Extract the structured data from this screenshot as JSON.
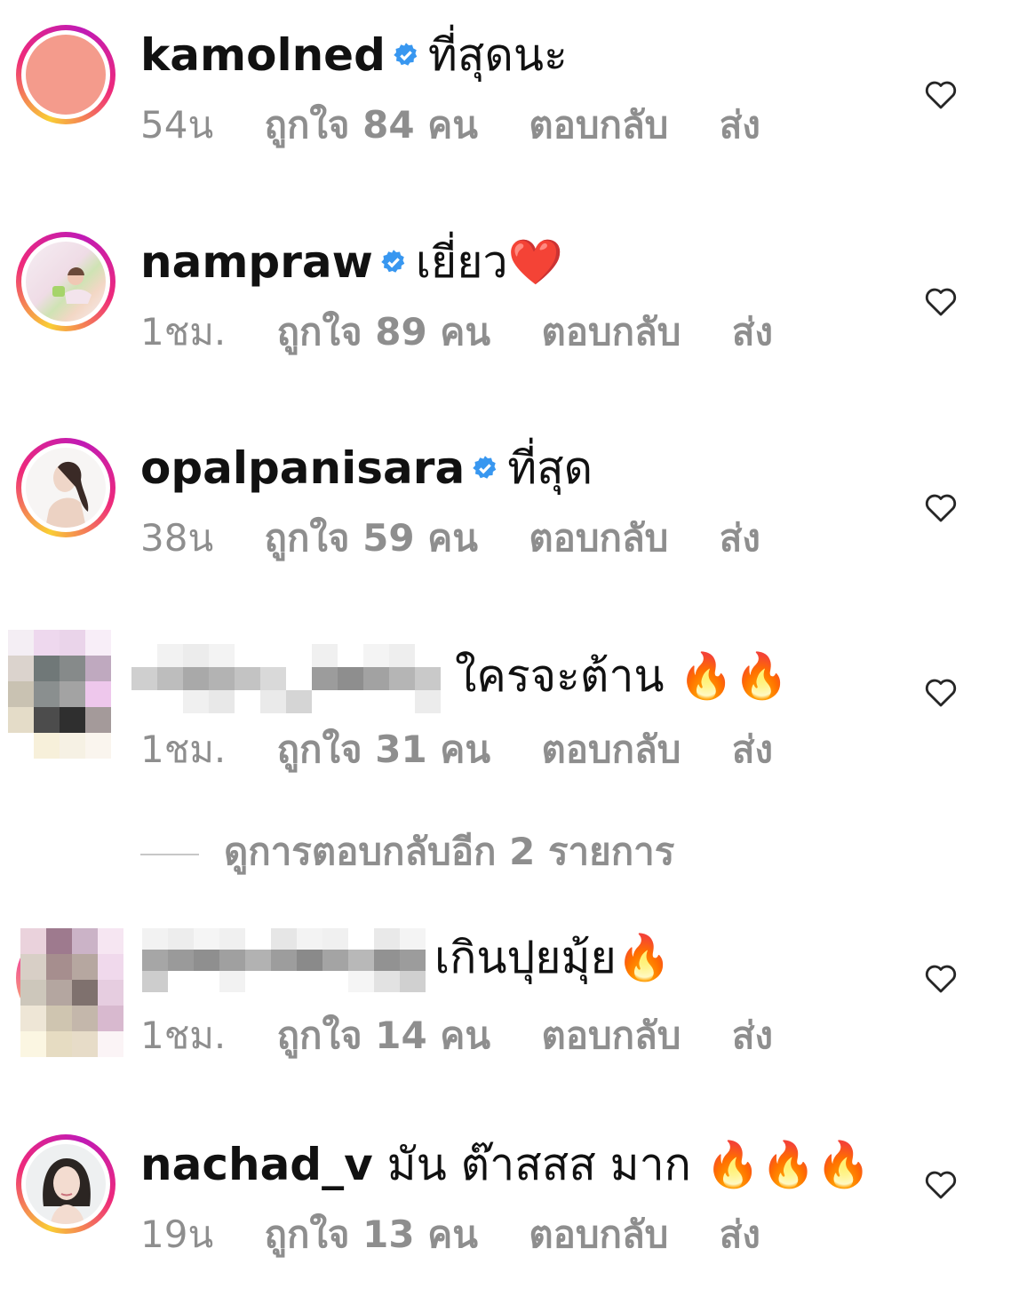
{
  "comments": [
    {
      "username": "kamolned",
      "verified": true,
      "text": "ที่สุดนะ",
      "time": "54น",
      "likes": "ถูกใจ 84 คน",
      "reply": "ตอบกลับ",
      "send": "ส่ง",
      "avatar_color": "#f49b8c"
    },
    {
      "username": "nampraw",
      "verified": true,
      "text": "เยี่ยว❤️",
      "time": "1ชม.",
      "likes": "ถูกใจ 89 คน",
      "reply": "ตอบกลับ",
      "send": "ส่ง"
    },
    {
      "username": "opalpanisara",
      "verified": true,
      "text": "ที่สุด",
      "time": "38น",
      "likes": "ถูกใจ 59 คน",
      "reply": "ตอบกลับ",
      "send": "ส่ง"
    },
    {
      "username": "",
      "blurred": true,
      "text": "ใครจะต้าน 🔥🔥",
      "time": "1ชม.",
      "likes": "ถูกใจ 31 คน",
      "reply": "ตอบกลับ",
      "send": "ส่ง"
    },
    {
      "username": "",
      "blurred": true,
      "text": "เกินปุยมุ้ย🔥",
      "time": "1ชม.",
      "likes": "ถูกใจ 14 คน",
      "reply": "ตอบกลับ",
      "send": "ส่ง"
    },
    {
      "username": "nachad_v",
      "verified": false,
      "text": "มัน ต๊าสสส มาก 🔥🔥🔥",
      "time": "19น",
      "likes": "ถูกใจ 13 คน",
      "reply": "ตอบกลับ",
      "send": "ส่ง"
    }
  ],
  "view_replies": "ดูการตอบกลับอีก 2 รายการ",
  "colors": {
    "verified": "#3897f0",
    "meta": "#8e8e8e",
    "text": "#111111"
  },
  "icons": {
    "like": "heart-outline-icon",
    "verified": "verified-badge-icon",
    "fire": "fire-emoji"
  }
}
